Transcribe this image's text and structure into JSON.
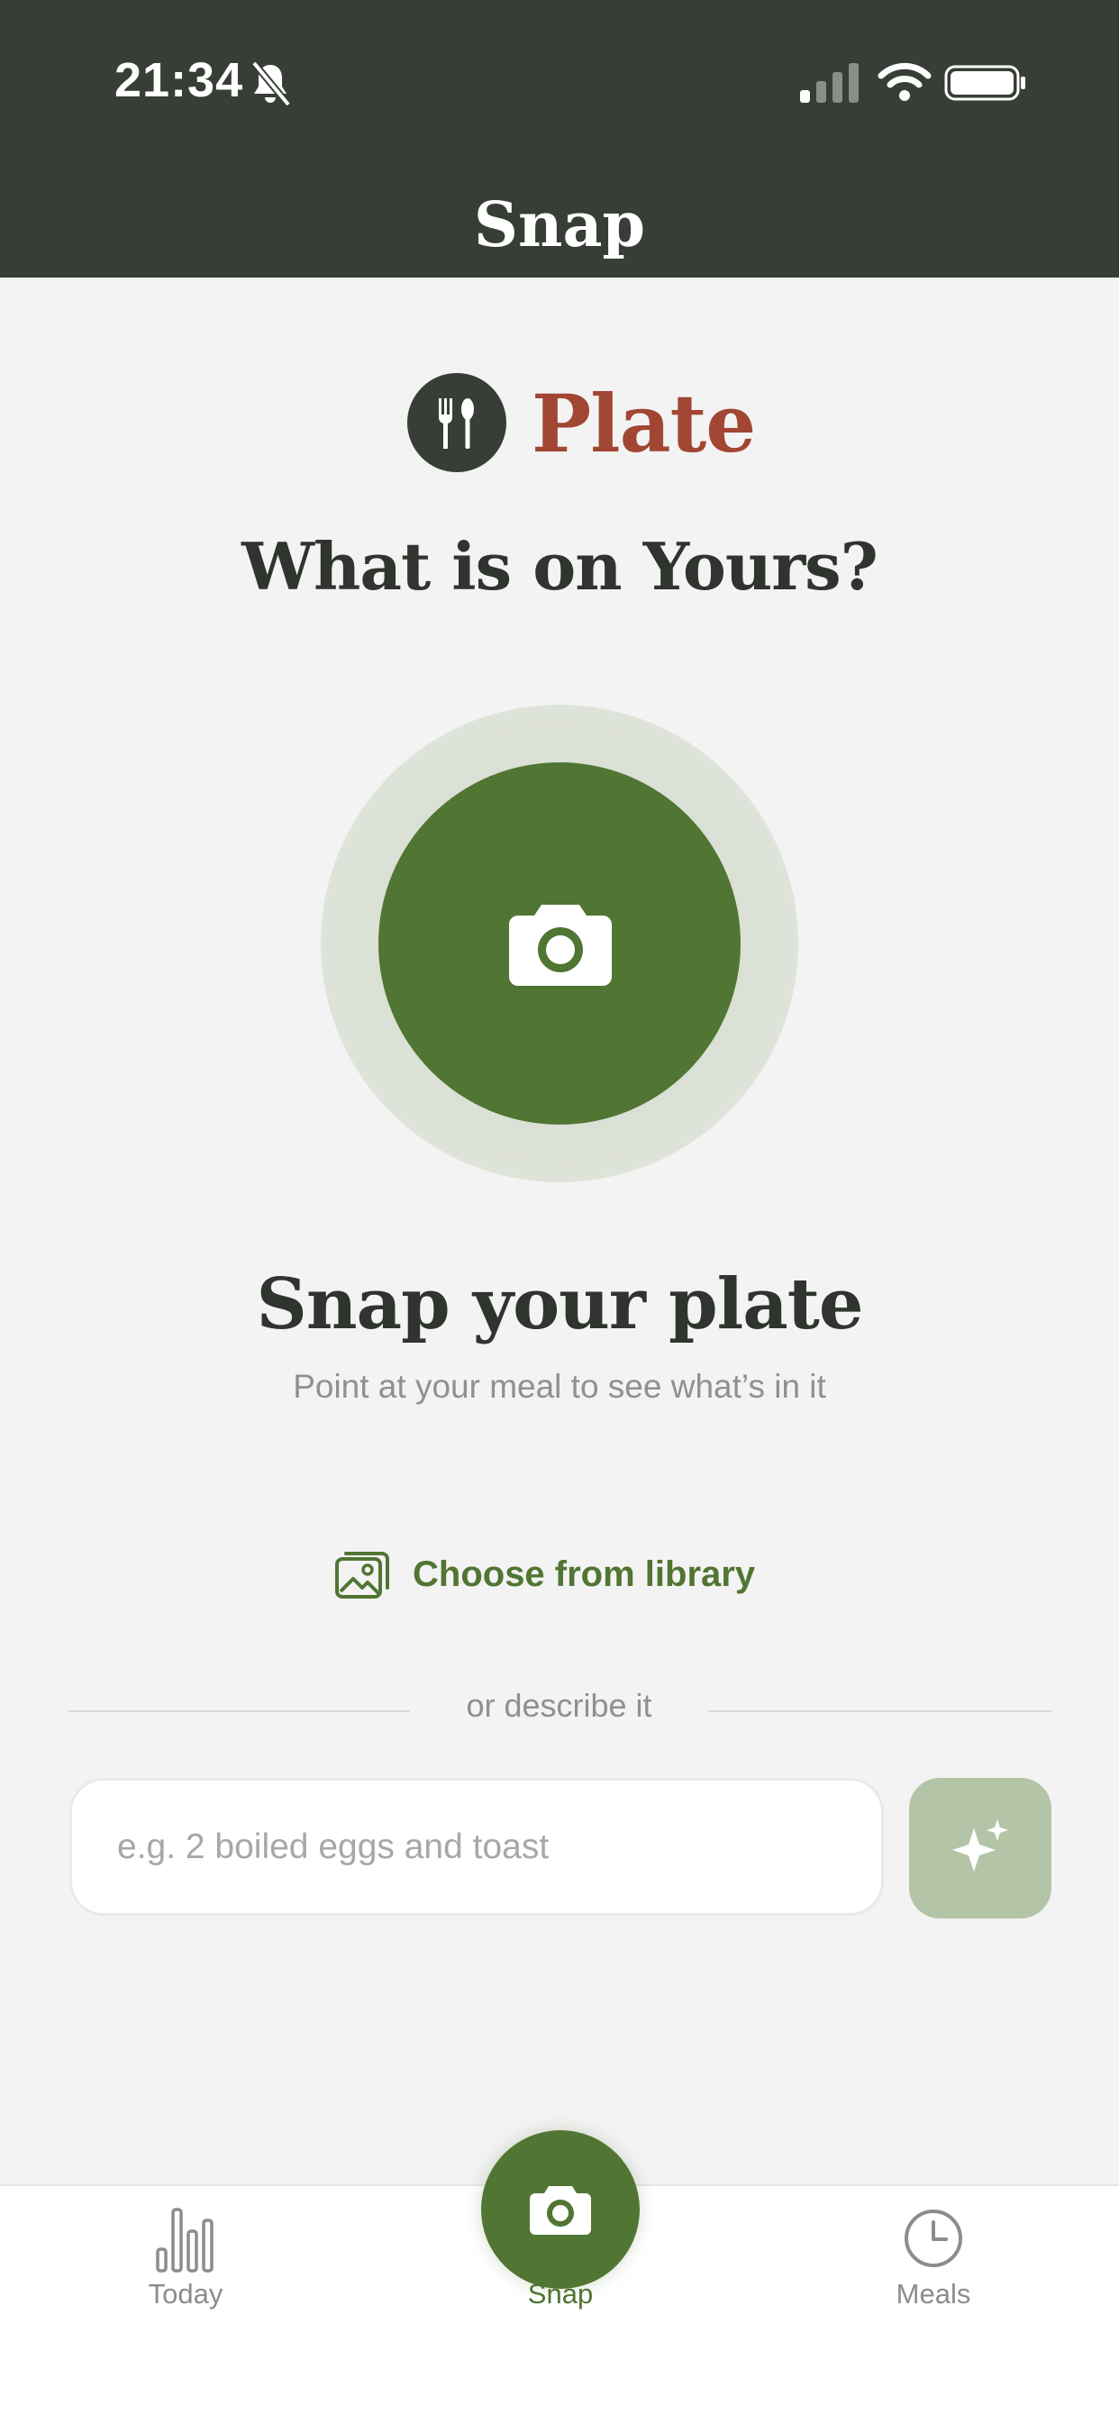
{
  "status_bar": {
    "time": "21:34",
    "icons": [
      "bell-slash-icon",
      "cellular-signal-icon",
      "wifi-icon",
      "battery-icon"
    ]
  },
  "header": {
    "title": "Snap"
  },
  "brand": {
    "icon": "fork-spoon-icon",
    "name": "Plate"
  },
  "main": {
    "headline": "What is on Yours?",
    "camera_icon": "camera-icon",
    "snap_title": "Snap your plate",
    "snap_subtitle": "Point at your meal to see what’s in it",
    "library_link": {
      "icon": "image-gallery-icon",
      "label": "Choose from library"
    },
    "divider_text": "or describe it",
    "describe_input": {
      "value": "",
      "placeholder": "e.g. 2 boiled eggs and toast"
    },
    "ai_button_icon": "sparkles-icon"
  },
  "bottom_nav": {
    "items": [
      {
        "label": "Today",
        "icon": "bar-chart-icon"
      },
      {
        "label": "Snap",
        "icon": "camera-icon",
        "active": true
      },
      {
        "label": "Meals",
        "icon": "clock-icon"
      }
    ]
  },
  "colors": {
    "header_bg": "#373e36",
    "accent_green": "#517532",
    "brand_red": "#a24634",
    "ai_button_bg": "#b4c5a7",
    "background": "#f3f3f3"
  }
}
